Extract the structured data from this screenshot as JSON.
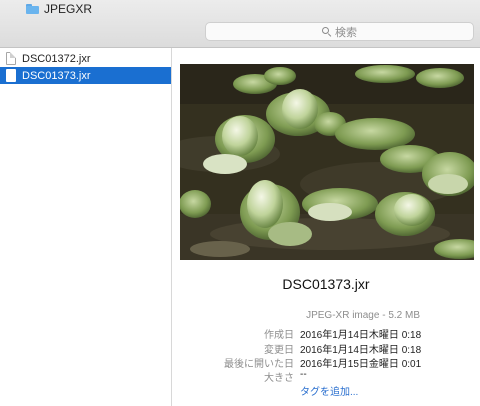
{
  "toolbar": {
    "folder_name": "JPEGXR",
    "search_placeholder": "検索"
  },
  "files": [
    {
      "name": "DSC01372.jxr",
      "selected": false
    },
    {
      "name": "DSC01373.jxr",
      "selected": true
    }
  ],
  "preview": {
    "title": "DSC01373.jxr",
    "kind": "JPEG-XR image - 5.2 MB",
    "info": [
      {
        "key": "作成日",
        "value": "2016年1月14日木曜日 0:18"
      },
      {
        "key": "変更日",
        "value": "2016年1月14日木曜日 0:18"
      },
      {
        "key": "最後に開いた日",
        "value": "2016年1月15日金曜日 0:01"
      },
      {
        "key": "大きさ",
        "value": "--"
      }
    ],
    "add_tags": "タグを追加..."
  },
  "colors": {
    "selection": "#1a6fd1",
    "folder": "#6ab4ee",
    "link": "#2a6fcf"
  }
}
